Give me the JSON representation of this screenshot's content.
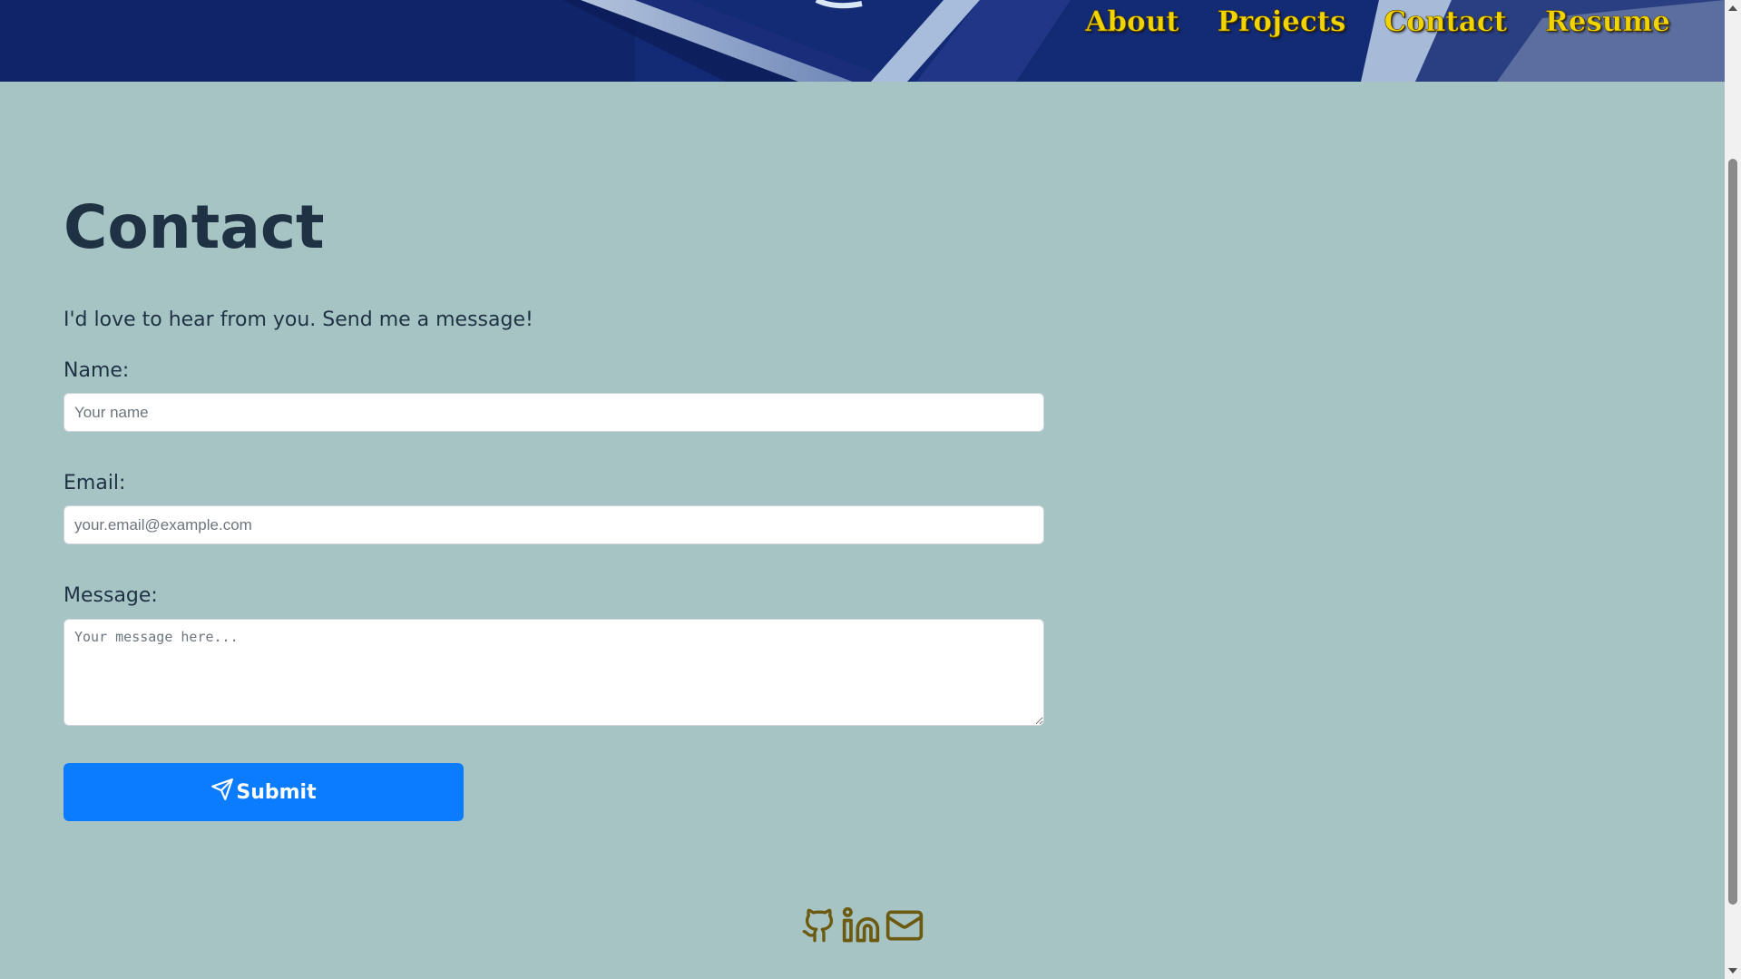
{
  "nav": {
    "items": [
      {
        "label": "About"
      },
      {
        "label": "Projects"
      },
      {
        "label": "Contact"
      },
      {
        "label": "Resume"
      }
    ]
  },
  "main": {
    "title": "Contact",
    "intro": "I'd love to hear from you. Send me a message!",
    "form": {
      "name_label": "Name:",
      "name_placeholder": "Your name",
      "name_value": "",
      "email_label": "Email:",
      "email_placeholder": "your.email@example.com",
      "email_value": "",
      "message_label": "Message:",
      "message_placeholder": "Your message here...",
      "message_value": "",
      "submit_label": "Submit"
    }
  },
  "footer": {
    "icons": [
      "github-icon",
      "linkedin-icon",
      "mail-icon"
    ]
  },
  "colors": {
    "background": "#a7c4c5",
    "heading": "#1f3244",
    "nav_text": "#f0d400",
    "button": "#0b7cff",
    "footer_icon": "#6b5a10"
  }
}
